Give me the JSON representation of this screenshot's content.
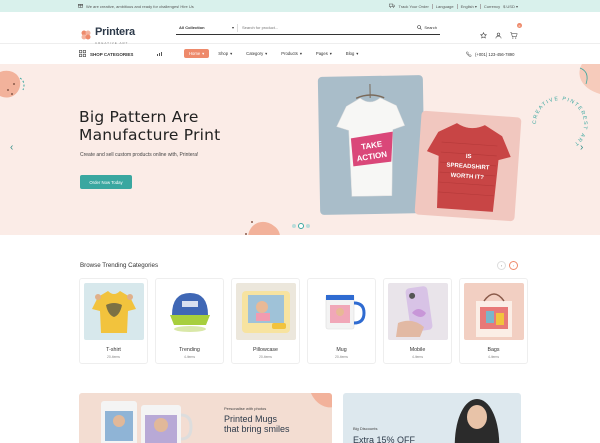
{
  "topbar": {
    "promo_text": "We are creative, ambitious and ready for challenges! Hire Us",
    "track_order": "Track Your Order",
    "language_label": "Language",
    "language_value": "English",
    "currency_label": "Currency",
    "currency_value": "$ USD"
  },
  "header": {
    "logo_name": "Printera",
    "logo_tagline": "CREATIVE ART",
    "search_category": "All Collection",
    "search_placeholder": "Search for product...",
    "search_button": "Search",
    "cart_count": "0"
  },
  "nav": {
    "shop_categories": "SHOP CATEGORIES",
    "items": [
      {
        "label": "Home",
        "active": true
      },
      {
        "label": "Shop",
        "active": false
      },
      {
        "label": "Category",
        "active": false
      },
      {
        "label": "Products",
        "active": false
      },
      {
        "label": "Pages",
        "active": false
      },
      {
        "label": "Blog",
        "active": false
      }
    ],
    "phone": "(+001) 123-456-7890"
  },
  "hero": {
    "title_line1": "Big Pattern Are",
    "title_line2": "Manufacture Print",
    "subtitle": "Create and sell custom products online with, Printera!",
    "cta": "Order Now Today",
    "shirt1_line1": "TAKE",
    "shirt1_line2": "ACTION",
    "shirt2_line1": "IS",
    "shirt2_line2": "SPREADSHIRT",
    "shirt2_line3": "WORTH IT?",
    "circle_text": "CREATIVE PINTEREST ART"
  },
  "trending": {
    "title": "Browse Trending Categories",
    "categories": [
      {
        "name": "T-shirt",
        "count": "20-items"
      },
      {
        "name": "Trending",
        "count": "4-items"
      },
      {
        "name": "Pillowcase",
        "count": "20-items"
      },
      {
        "name": "Mug",
        "count": "20-items"
      },
      {
        "name": "Mobile",
        "count": "4-items"
      },
      {
        "name": "Bags",
        "count": "4-items"
      }
    ]
  },
  "promos": {
    "mugs_small": "Personalise with photos",
    "mugs_big_line1": "Printed Mugs",
    "mugs_big_line2": "that bring smiles",
    "discount_small": "Big Discounts",
    "discount_big": "Extra 15% OFF"
  },
  "colors": {
    "accent_coral": "#ee8a6b",
    "accent_teal": "#3aa7a0",
    "hero_bg": "#fbece7",
    "topbar_bg": "#d9f1ec"
  }
}
